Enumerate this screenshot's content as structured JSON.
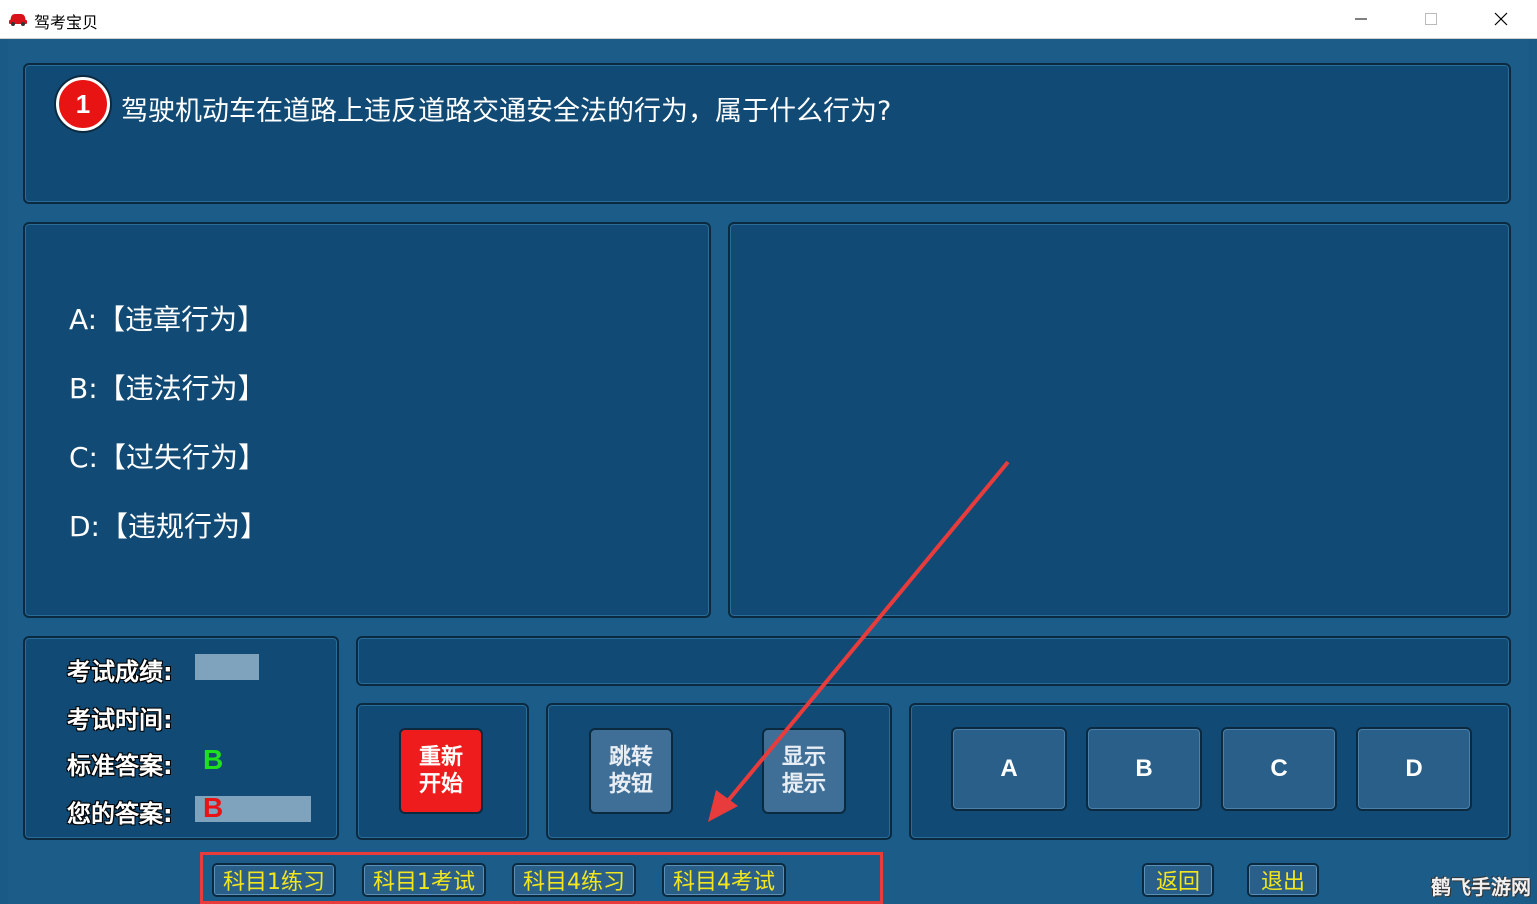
{
  "window": {
    "title": "驾考宝贝",
    "accent": "#114a74"
  },
  "question": {
    "number": "1",
    "text": "驾驶机动车在道路上违反道路交通安全法的行为，属于什么行为?"
  },
  "options": [
    {
      "text": "A:【违章行为】"
    },
    {
      "text": "B:【违法行为】"
    },
    {
      "text": "C:【过失行为】"
    },
    {
      "text": "D:【违规行为】"
    }
  ],
  "info": {
    "score_label": "考试成绩:",
    "time_label": "考试时间:",
    "standard_label": "标准答案:",
    "standard_value": "B",
    "yours_label": "您的答案:",
    "yours_value": "B"
  },
  "controls": {
    "restart": [
      "重新",
      "开始"
    ],
    "jump": [
      "跳转",
      "按钮"
    ],
    "hint": [
      "显示",
      "提示"
    ]
  },
  "answer_buttons": [
    "A",
    "B",
    "C",
    "D"
  ],
  "nav": {
    "k1_practice": "科目1练习",
    "k1_exam": "科目1考试",
    "k4_practice": "科目4练习",
    "k4_exam": "科目4考试",
    "back": "返回",
    "exit": "退出"
  },
  "watermark": "鹤飞手游网",
  "colors": {
    "correct": "#1ee01e",
    "wrong": "#e81414",
    "nav_text": "#f3e61d",
    "annotation": "#e83c3c"
  }
}
